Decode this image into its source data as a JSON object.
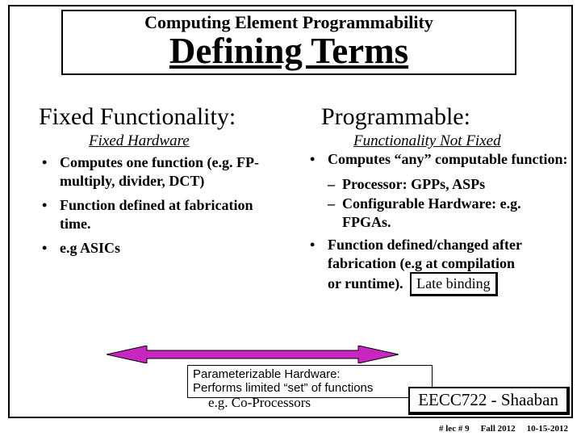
{
  "pretitle": "Computing Element Programmability",
  "title": "Defining Terms",
  "left": {
    "heading": "Fixed Functionality:",
    "sub": "Fixed Hardware",
    "b1": "Computes one function (e.g. FP-multiply, divider, DCT)",
    "b2": "Function defined at fabrication time.",
    "b3": "e.g ASICs"
  },
  "right": {
    "heading": "Programmable:",
    "sub": "Functionality Not Fixed",
    "b1": "Computes “any” computable function:",
    "s1": "Processor: GPPs, ASPs",
    "s2": "Configurable Hardware: e.g. FPGAs.",
    "b2a": "Function defined/changed after fabrication (e.g at compilation",
    "b2b": "or runtime).",
    "late": "Late binding"
  },
  "param": {
    "l1": "Parameterizable Hardware:",
    "l2": "Performs limited “set” of functions",
    "coproc": "e.g. Co-Processors"
  },
  "course": "EECC722 - Shaaban",
  "footer": {
    "lec": "#  lec # 9",
    "term": "Fall 2012",
    "date": "10-15-2012"
  }
}
